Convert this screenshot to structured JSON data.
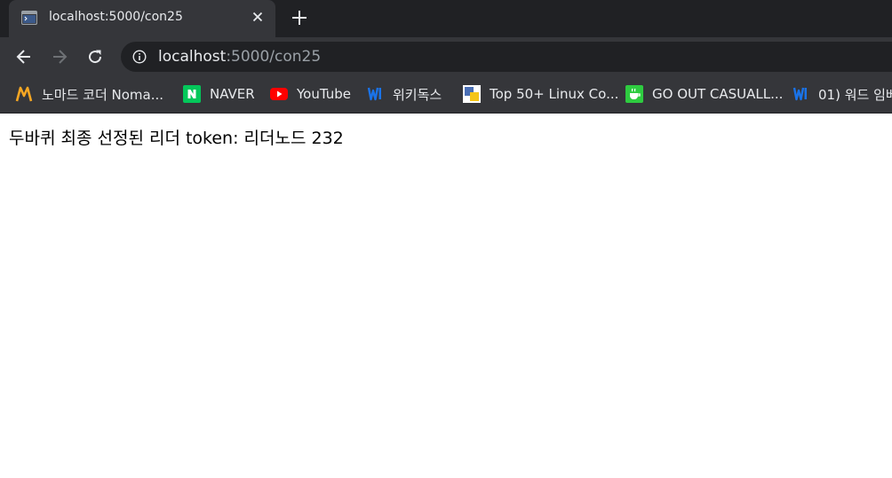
{
  "tab": {
    "title": "localhost:5000/con25",
    "favicon": "terminal-page-icon"
  },
  "toolbar": {
    "url_host": "localhost",
    "url_rest": ":5000/con25"
  },
  "bookmarks": [
    {
      "label": "노마드 코더 Noma...",
      "icon": "nomad-coder-icon"
    },
    {
      "label": "NAVER",
      "icon": "naver-icon"
    },
    {
      "label": "YouTube",
      "icon": "youtube-icon"
    },
    {
      "label": "위키독스",
      "icon": "wikidocs-icon"
    },
    {
      "label": "Top 50+ Linux Co...",
      "icon": "linux-site-icon"
    },
    {
      "label": "GO OUT CASUALL...",
      "icon": "gooutcasual-icon"
    },
    {
      "label": "01) 워드 임베",
      "icon": "wikidocs-icon"
    }
  ],
  "page": {
    "text": "두바퀴 최종 선정된 리더 token: 리더노드 232"
  },
  "colors": {
    "tabstrip": "#202124",
    "toolbar": "#35363a",
    "omnibox": "#202124",
    "text_light": "#e8eaed",
    "text_dim": "#9aa0a6",
    "page_bg": "#ffffff"
  }
}
